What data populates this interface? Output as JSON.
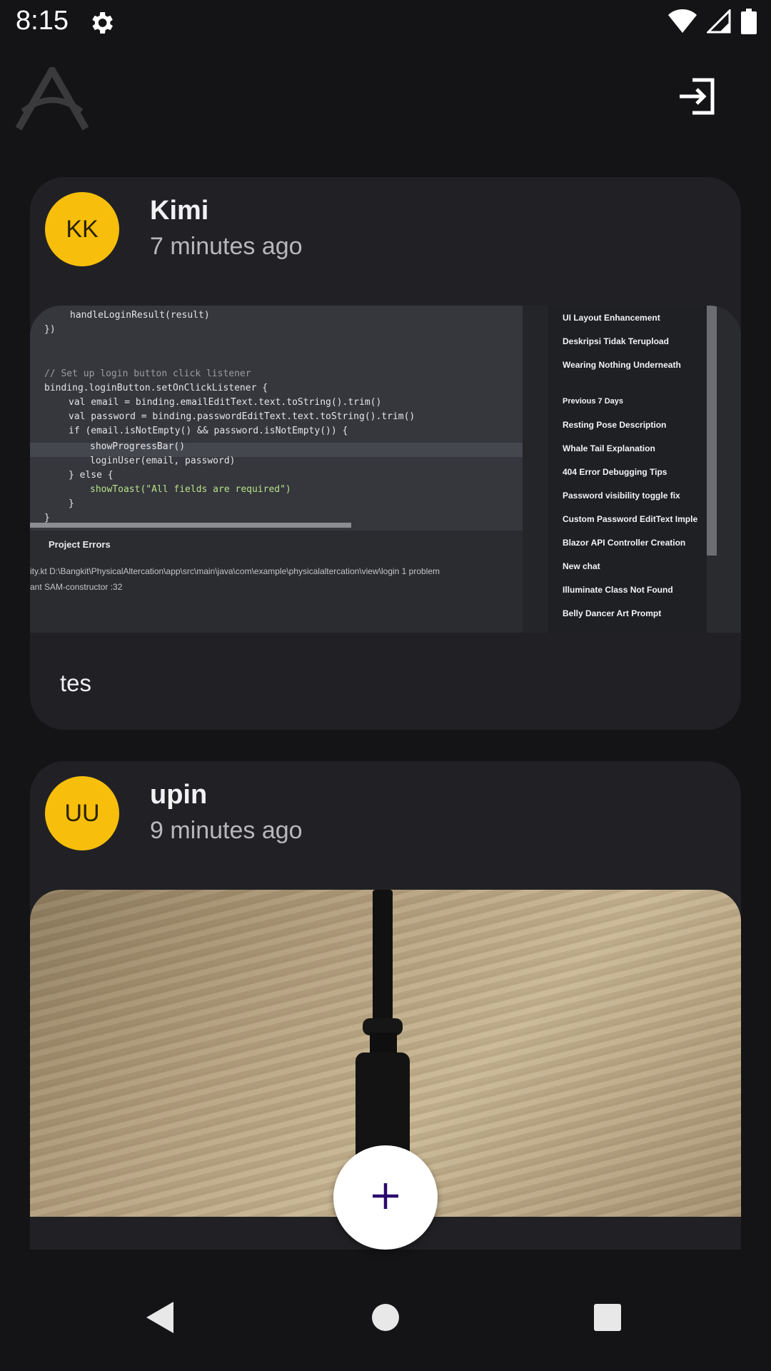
{
  "status_bar": {
    "time": "8:15",
    "icons": [
      "gear-icon",
      "wifi-icon",
      "signal-icon",
      "battery-icon"
    ]
  },
  "app_bar": {
    "logo_icon": "app-logo-icon",
    "logout_icon": "logout-icon"
  },
  "posts": [
    {
      "avatar_initials": "KK",
      "username": "Kimi",
      "time_ago": "7 minutes ago",
      "image_text": {
        "code_lines": [
          "handleLoginResult(result)",
          "})",
          "// Set up login button click listener",
          "binding.loginButton.setOnClickListener {",
          "val email = binding.emailEditText.text.toString().trim()",
          "val password = binding.passwordEditText.text.toString().trim()",
          "if (email.isNotEmpty() && password.isNotEmpty()) {",
          "showProgressBar()",
          "loginUser(email, password)",
          "} else {",
          "showToast(\"All fields are required\")",
          "}",
          "}"
        ],
        "errors_title": "Project Errors",
        "errors_path": "ity.kt  D:\\Bangkit\\PhysicalAltercation\\app\\src\\main\\java\\com\\example\\physicalaltercation\\view\\login  1 problem",
        "errors_item": "ant SAM-constructor :32",
        "side_items": [
          "UI Layout Enhancement",
          "Deskripsi Tidak Terupload",
          "Wearing Nothing Underneath",
          "Previous 7 Days",
          "Resting Pose Description",
          "Whale Tail Explanation",
          "404 Error Debugging Tips",
          "Password visibility toggle fix",
          "Custom Password EditText Imple",
          "Blazor API Controller Creation",
          "New chat",
          "Illuminate Class Not Found",
          "Belly Dancer Art Prompt"
        ]
      },
      "caption": "tes"
    },
    {
      "avatar_initials": "UU",
      "username": "upin",
      "time_ago": "9 minutes ago",
      "caption": ""
    }
  ],
  "fab": {
    "icon": "plus-icon"
  },
  "nav_bar": {
    "icons": [
      "back-icon",
      "home-icon",
      "recents-icon"
    ]
  },
  "colors": {
    "background": "#141416",
    "card": "#212125",
    "avatar": "#f7bf0b",
    "fab_icon": "#2b0a6e"
  }
}
